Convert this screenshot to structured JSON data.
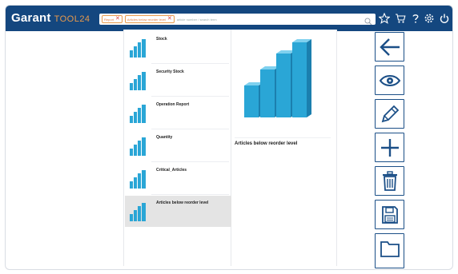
{
  "app": {
    "logo_main": "Garant",
    "logo_sub": "TOOL24"
  },
  "search": {
    "chips": [
      "Report",
      "Articles below reorder level"
    ],
    "hint": "article number / search term"
  },
  "header_icons": [
    "star-icon",
    "cart-icon",
    "help-icon",
    "settings-icon",
    "power-icon"
  ],
  "reports": [
    {
      "label": "Stock",
      "selected": false
    },
    {
      "label": "Security Stock",
      "selected": false
    },
    {
      "label": "Operation Report",
      "selected": false
    },
    {
      "label": "Quantity",
      "selected": false
    },
    {
      "label": "Critical_Articles",
      "selected": false
    },
    {
      "label": "Articles below reorder level",
      "selected": true
    }
  ],
  "detail": {
    "title": "Articles below reorder level"
  },
  "toolbar": [
    "back-arrow-icon",
    "eye-icon",
    "pencil-icon",
    "plus-icon",
    "trash-icon",
    "save-icon",
    "folder-icon"
  ],
  "colors": {
    "header": "#14477f",
    "accent": "#e89a4c",
    "chart": "#2aa6d6",
    "selected": "#e4e4e4"
  }
}
